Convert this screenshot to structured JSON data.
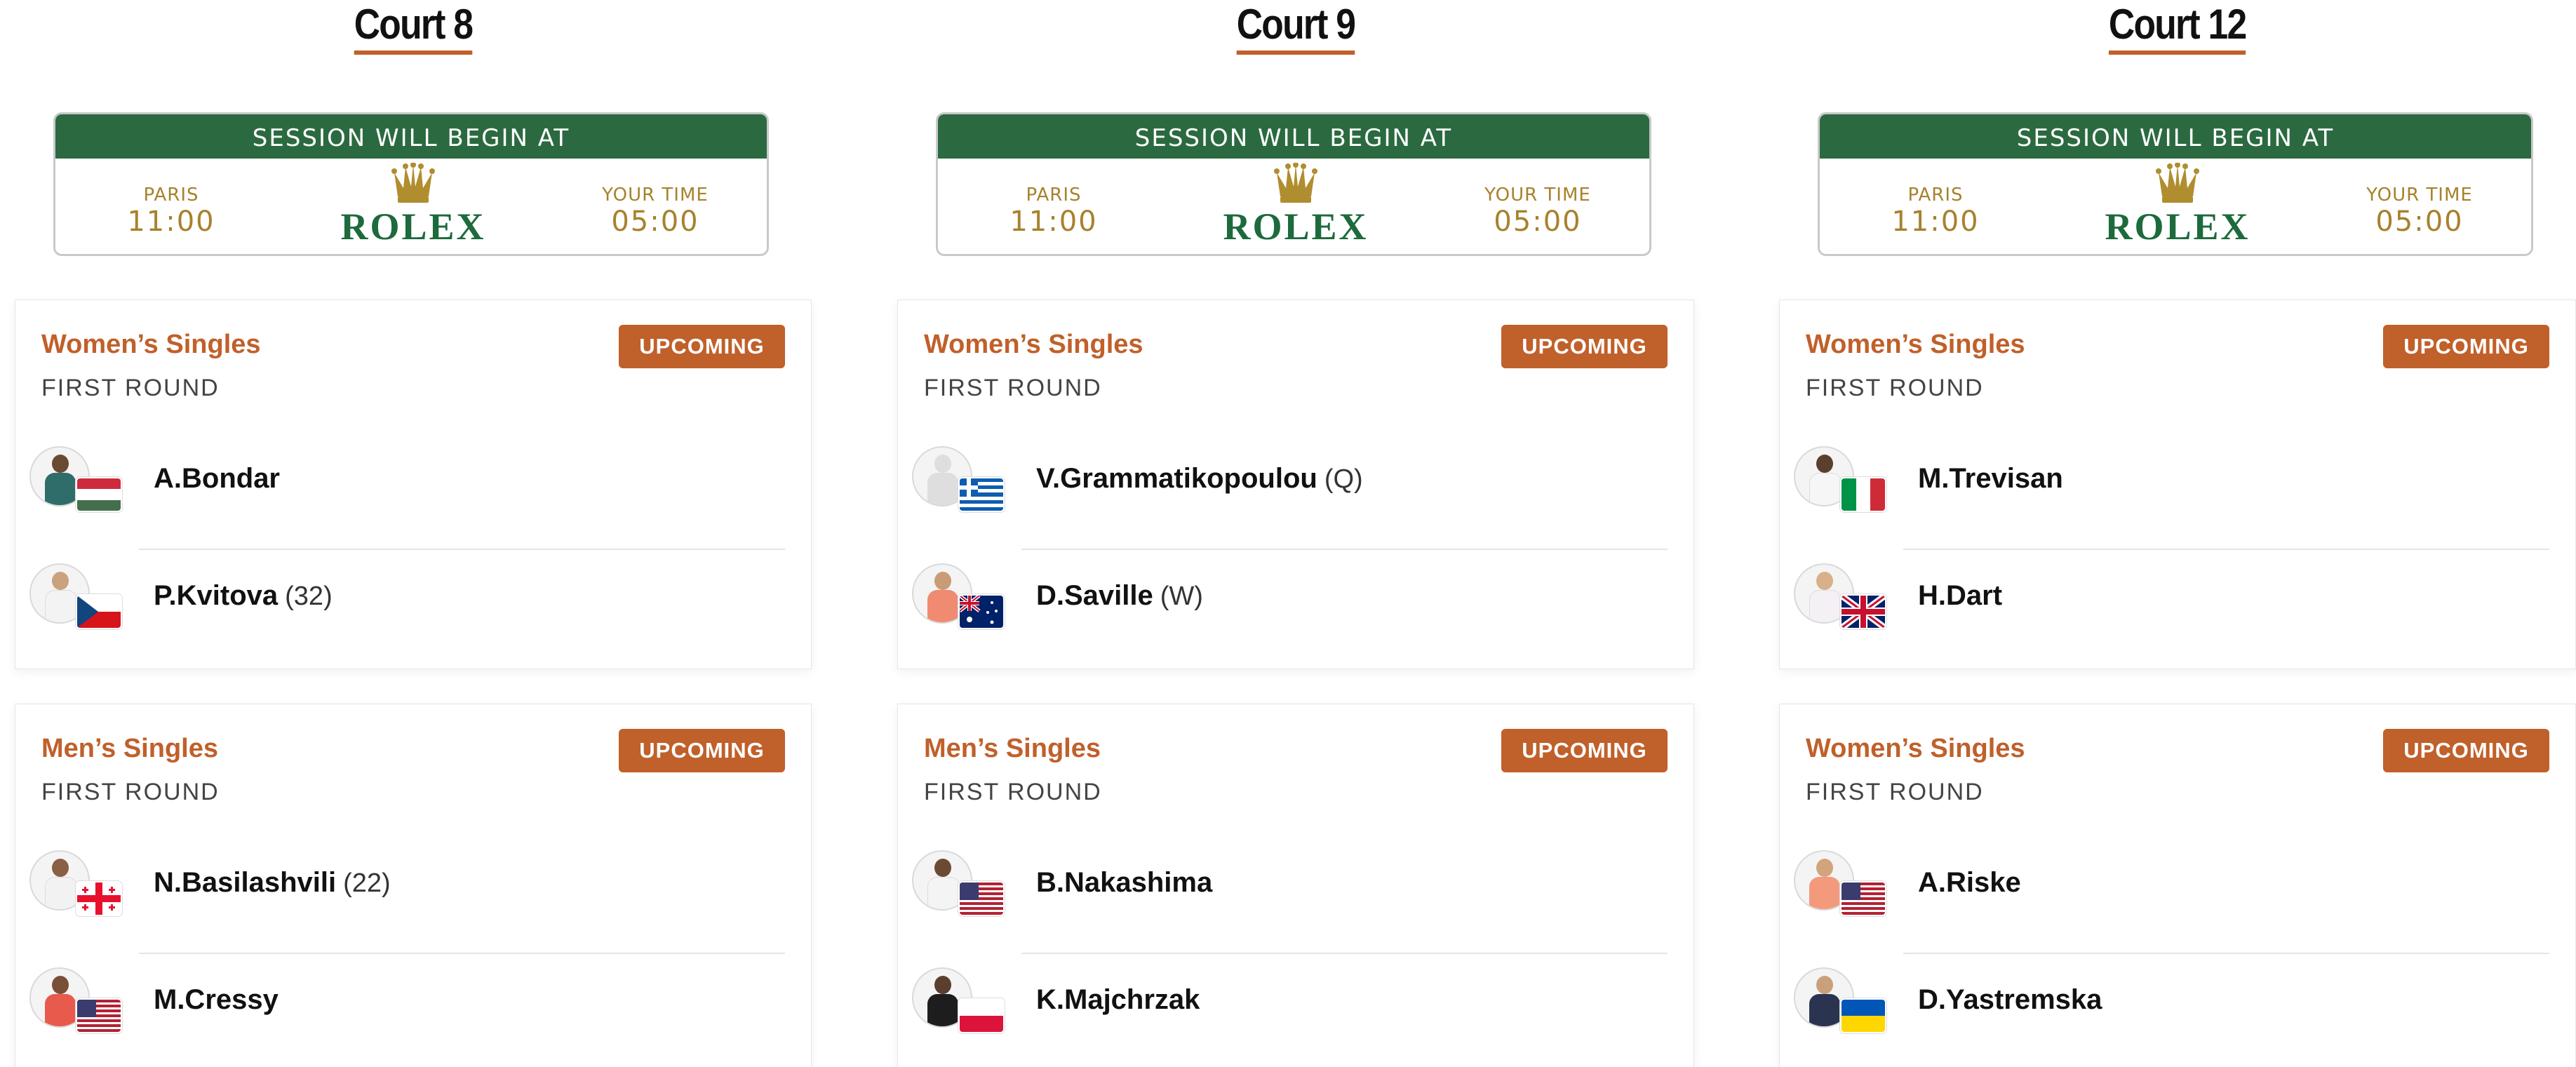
{
  "session": {
    "header": "SESSION WILL BEGIN AT",
    "paris_label": "PARIS",
    "paris_time": "11:00",
    "your_label": "YOUR TIME",
    "your_time": "05:00",
    "brand": "ROLEX"
  },
  "status_label": "UPCOMING",
  "colors": {
    "accent": "#c0602a",
    "rolex_green": "#2b6a40",
    "gold": "#a7822c"
  },
  "courts": [
    {
      "title": "Court 8",
      "matches": [
        {
          "event": "Women’s Singles",
          "round": "FIRST ROUND",
          "players": [
            {
              "name": "A.Bondar",
              "seed": "",
              "flag": "hungary-flag"
            },
            {
              "name": "P.Kvitova",
              "seed": "(32)",
              "flag": "czech-flag"
            }
          ]
        },
        {
          "event": "Men’s Singles",
          "round": "FIRST ROUND",
          "players": [
            {
              "name": "N.Basilashvili",
              "seed": "(22)",
              "flag": "georgia-flag"
            },
            {
              "name": "M.Cressy",
              "seed": "",
              "flag": "usa-flag"
            }
          ]
        }
      ]
    },
    {
      "title": "Court 9",
      "matches": [
        {
          "event": "Women’s Singles",
          "round": "FIRST ROUND",
          "players": [
            {
              "name": "V.Grammatikopoulou",
              "seed": "(Q)",
              "flag": "greece-flag"
            },
            {
              "name": "D.Saville",
              "seed": "(W)",
              "flag": "australia-flag"
            }
          ]
        },
        {
          "event": "Men’s Singles",
          "round": "FIRST ROUND",
          "players": [
            {
              "name": "B.Nakashima",
              "seed": "",
              "flag": "usa-flag"
            },
            {
              "name": "K.Majchrzak",
              "seed": "",
              "flag": "poland-flag"
            }
          ]
        }
      ]
    },
    {
      "title": "Court 12",
      "matches": [
        {
          "event": "Women’s Singles",
          "round": "FIRST ROUND",
          "players": [
            {
              "name": "M.Trevisan",
              "seed": "",
              "flag": "italy-flag"
            },
            {
              "name": "H.Dart",
              "seed": "",
              "flag": "uk-flag"
            }
          ]
        },
        {
          "event": "Women’s Singles",
          "round": "FIRST ROUND",
          "players": [
            {
              "name": "A.Riske",
              "seed": "",
              "flag": "usa-flag"
            },
            {
              "name": "D.Yastremska",
              "seed": "",
              "flag": "ukraine-flag"
            }
          ]
        }
      ]
    }
  ]
}
